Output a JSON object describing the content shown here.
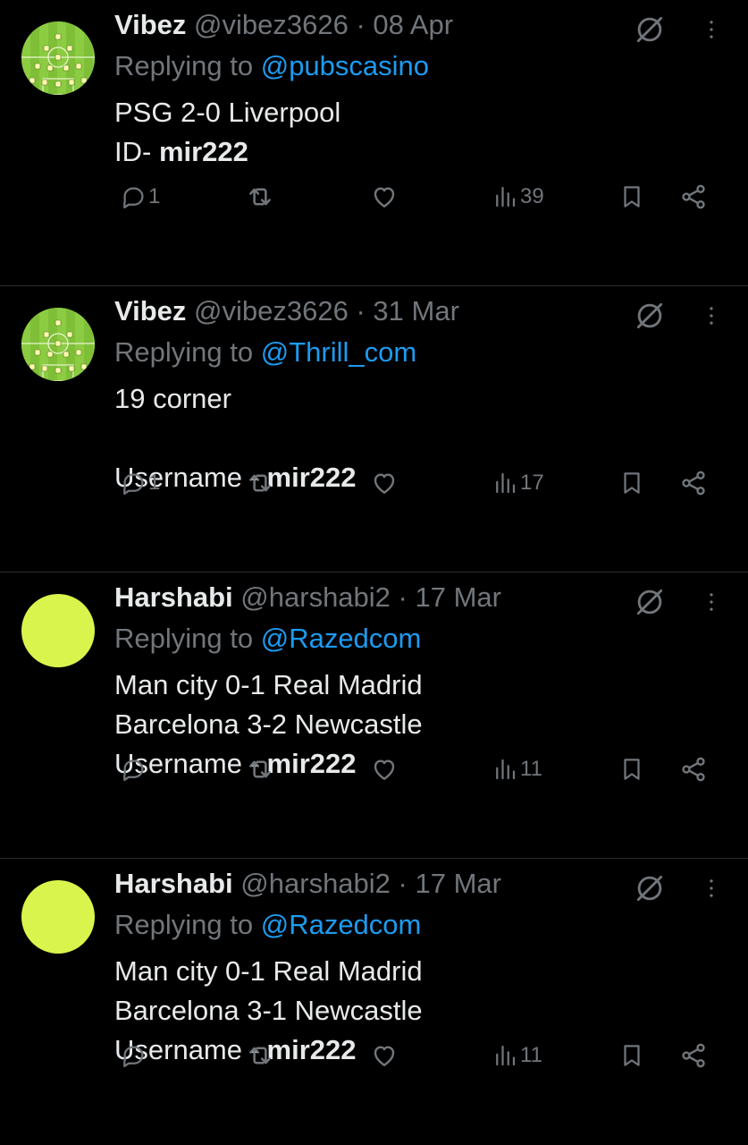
{
  "tweets": [
    {
      "avatar_type": "football-pitch",
      "name": "Vibez",
      "handle": "@vibez3626",
      "date": "08 Apr",
      "replying_prefix": "Replying to",
      "replying_to": "@pubscasino",
      "lines": [
        {
          "text": "PSG 2-0 Liverpool",
          "bold": ""
        },
        {
          "text": "ID- ",
          "bold": "mir222"
        }
      ],
      "stats": {
        "replies": "1",
        "views": "39"
      }
    },
    {
      "avatar_type": "football-pitch",
      "name": "Vibez",
      "handle": "@vibez3626",
      "date": "31 Mar",
      "replying_prefix": "Replying to",
      "replying_to": "@Thrill_com",
      "lines": [
        {
          "text": "19 corner",
          "bold": ""
        },
        {
          "text": "",
          "bold": ""
        },
        {
          "text": "Username - ",
          "bold": "mir222"
        }
      ],
      "stats": {
        "replies": "1",
        "views": "17"
      }
    },
    {
      "avatar_type": "solid-lime",
      "name": "Harshabi",
      "handle": "@harshabi2",
      "date": "17 Mar",
      "replying_prefix": "Replying to",
      "replying_to": "@Razedcom",
      "lines": [
        {
          "text": "Man city 0-1 Real Madrid",
          "bold": ""
        },
        {
          "text": "Barcelona 3-2 Newcastle",
          "bold": ""
        },
        {
          "text": "Username - ",
          "bold": "mir222"
        }
      ],
      "stats": {
        "replies": "",
        "views": "11"
      }
    },
    {
      "avatar_type": "solid-lime",
      "name": "Harshabi",
      "handle": "@harshabi2",
      "date": "17 Mar",
      "replying_prefix": "Replying to",
      "replying_to": "@Razedcom",
      "lines": [
        {
          "text": "Man city 0-1 Real Madrid",
          "bold": ""
        },
        {
          "text": "Barcelona 3-1 Newcastle",
          "bold": ""
        },
        {
          "text": "Username - ",
          "bold": "mir222"
        }
      ],
      "stats": {
        "replies": "",
        "views": "11"
      }
    }
  ],
  "icons": {
    "reply": "reply-icon",
    "retweet": "retweet-icon",
    "like": "like-icon",
    "views": "views-icon",
    "bookmark": "bookmark-icon",
    "share": "share-icon",
    "grok": "grok-icon",
    "more": "more-icon"
  },
  "colors": {
    "background": "#000000",
    "text": "#e7e9ea",
    "muted": "#71767b",
    "link": "#1d9bf0",
    "avatar_lime": "#d9f54d",
    "divider": "#2a2d31"
  }
}
